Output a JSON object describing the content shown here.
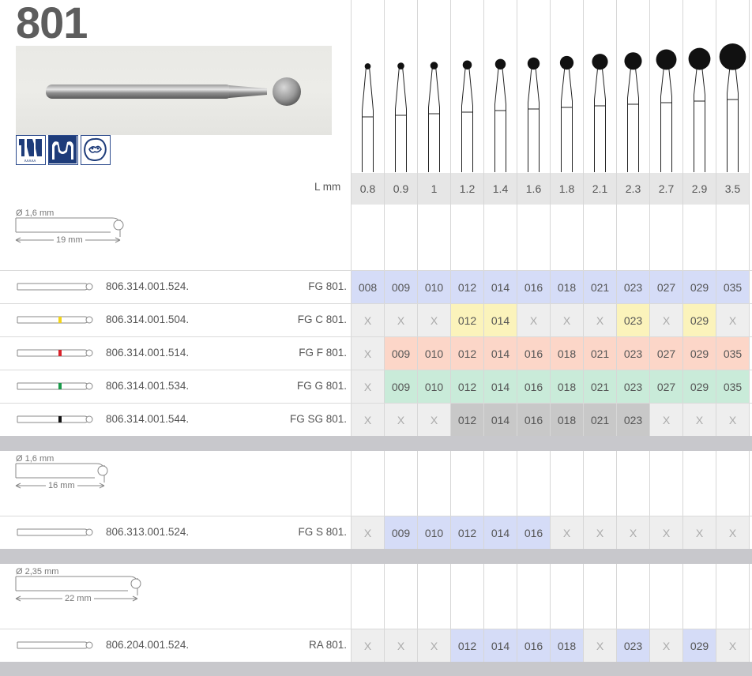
{
  "title": "801",
  "header_label": "L mm",
  "sizes": [
    "0.8",
    "0.9",
    "1",
    "1.2",
    "1.4",
    "1.6",
    "1.8",
    "2.1",
    "2.3",
    "2.7",
    "2.9",
    "3.5"
  ],
  "size_values": [
    0.8,
    0.9,
    1,
    1.2,
    1.4,
    1.6,
    1.8,
    2.1,
    2.3,
    2.7,
    2.9,
    3.5
  ],
  "colors": {
    "blue": "#d5dcf7",
    "yellow": "#fbf3bb",
    "orange": "#fcd6c8",
    "green": "#c9ebd9",
    "gray": "#c8c8c8",
    "x_bg": "#eeeeee"
  },
  "groups": [
    {
      "diameter": "Ø 1,6 mm",
      "length": "19 mm",
      "rows": [
        {
          "article": "806.314.001.524.",
          "code": "FG 801.",
          "color": "blue",
          "stripe": "",
          "cells": [
            "008",
            "009",
            "010",
            "012",
            "014",
            "016",
            "018",
            "021",
            "023",
            "027",
            "029",
            "035"
          ]
        },
        {
          "article": "806.314.001.504.",
          "code": "FG C 801.",
          "color": "yellow",
          "stripe": "#f2d41a",
          "cells": [
            "X",
            "X",
            "X",
            "012",
            "014",
            "X",
            "X",
            "X",
            "023",
            "X",
            "029",
            "X"
          ]
        },
        {
          "article": "806.314.001.514.",
          "code": "FG F 801.",
          "color": "orange",
          "stripe": "#d8232a",
          "cells": [
            "X",
            "009",
            "010",
            "012",
            "014",
            "016",
            "018",
            "021",
            "023",
            "027",
            "029",
            "035"
          ]
        },
        {
          "article": "806.314.001.534.",
          "code": "FG G 801.",
          "color": "green",
          "stripe": "#1a9a4a",
          "cells": [
            "X",
            "009",
            "010",
            "012",
            "014",
            "016",
            "018",
            "021",
            "023",
            "027",
            "029",
            "035"
          ]
        },
        {
          "article": "806.314.001.544.",
          "code": "FG SG 801.",
          "color": "gray",
          "stripe": "#111111",
          "cells": [
            "X",
            "X",
            "X",
            "012",
            "014",
            "016",
            "018",
            "021",
            "023",
            "X",
            "X",
            "X"
          ]
        }
      ]
    },
    {
      "diameter": "Ø 1,6 mm",
      "length": "16 mm",
      "rows": [
        {
          "article": "806.313.001.524.",
          "code": "FG S 801.",
          "color": "blue",
          "stripe": "",
          "cells": [
            "X",
            "009",
            "010",
            "012",
            "014",
            "016",
            "X",
            "X",
            "X",
            "X",
            "X",
            "X"
          ]
        }
      ]
    },
    {
      "diameter": "Ø 2,35 mm",
      "length": "22 mm",
      "rows": [
        {
          "article": "806.204.001.524.",
          "code": "RA 801.",
          "color": "blue",
          "stripe": "",
          "cells": [
            "X",
            "X",
            "X",
            "012",
            "014",
            "016",
            "018",
            "X",
            "023",
            "X",
            "029",
            "X"
          ]
        }
      ]
    }
  ]
}
